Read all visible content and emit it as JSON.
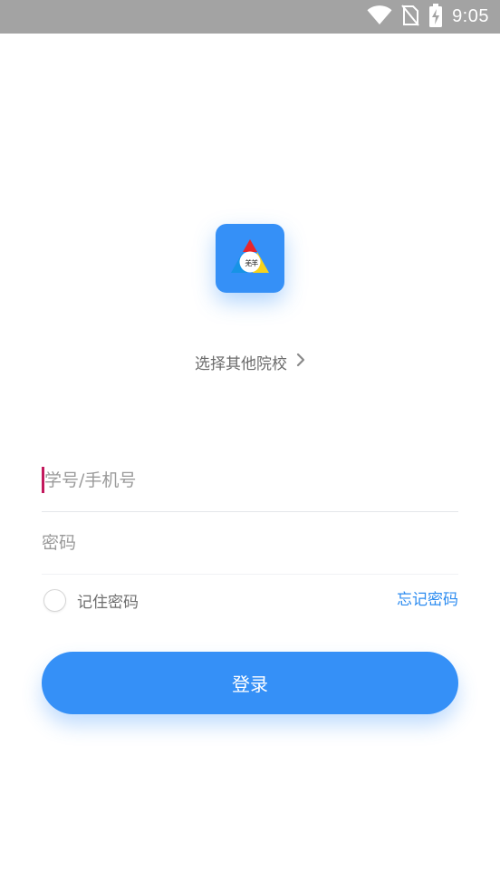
{
  "status_bar": {
    "time": "9:05",
    "icons": [
      "wifi-icon",
      "no-sim-icon",
      "battery-charging-icon"
    ]
  },
  "logo": {
    "icon": "school-logo-icon"
  },
  "school_selector": {
    "label": "选择其他院校",
    "icon": "chevron-right-icon"
  },
  "form": {
    "account_placeholder": "学号/手机号",
    "account_value": "",
    "password_placeholder": "密码",
    "password_value": "",
    "remember_label": "记住密码",
    "remember_checked": false,
    "forgot_label": "忘记密码"
  },
  "login_button": {
    "label": "登录"
  },
  "colors": {
    "accent": "#3590f7",
    "link": "#2d8cf0",
    "caret": "#c3195d",
    "status_bar": "#a3a3a3"
  }
}
